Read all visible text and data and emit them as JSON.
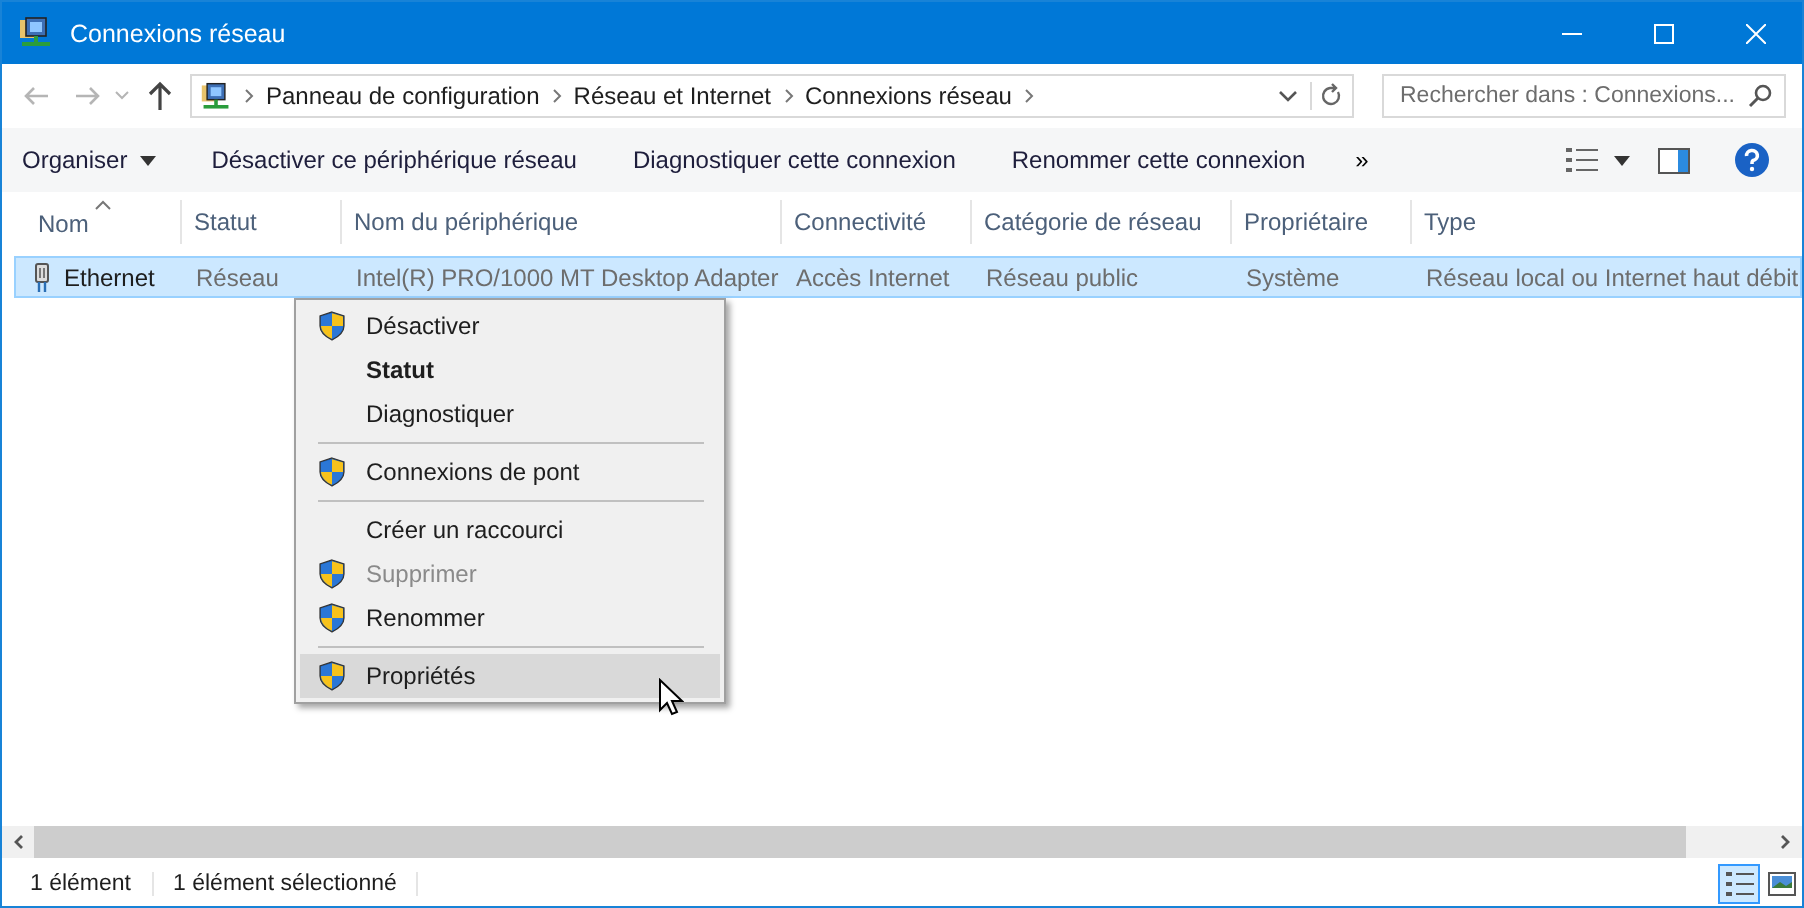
{
  "window": {
    "title": "Connexions réseau"
  },
  "address": {
    "crumbs": [
      "Panneau de configuration",
      "Réseau et Internet",
      "Connexions réseau"
    ]
  },
  "search": {
    "placeholder": "Rechercher dans : Connexions..."
  },
  "toolbar": {
    "items": [
      {
        "label": "Organiser",
        "dropdown": true
      },
      {
        "label": "Désactiver ce périphérique réseau",
        "dropdown": false
      },
      {
        "label": "Diagnostiquer cette connexion",
        "dropdown": false
      },
      {
        "label": "Renommer cette connexion",
        "dropdown": false
      }
    ],
    "more": "»"
  },
  "table": {
    "columns": [
      {
        "label": "Nom",
        "sorted": true
      },
      {
        "label": "Statut",
        "sorted": false
      },
      {
        "label": "Nom du périphérique",
        "sorted": false
      },
      {
        "label": "Connectivité",
        "sorted": false
      },
      {
        "label": "Catégorie de réseau",
        "sorted": false
      },
      {
        "label": "Propriétaire",
        "sorted": false
      },
      {
        "label": "Type",
        "sorted": false
      }
    ],
    "rows": [
      {
        "selected": true,
        "cells": [
          "Ethernet",
          "Réseau",
          "Intel(R) PRO/1000 MT Desktop Adapter",
          "Accès Internet",
          "Réseau public",
          "Système",
          "Réseau local ou Internet haut débit"
        ]
      }
    ]
  },
  "context_menu": {
    "items": [
      {
        "kind": "item",
        "label": "Désactiver",
        "shield": true,
        "bold": false,
        "disabled": false,
        "selected": false
      },
      {
        "kind": "item",
        "label": "Statut",
        "shield": false,
        "bold": true,
        "disabled": false,
        "selected": false
      },
      {
        "kind": "item",
        "label": "Diagnostiquer",
        "shield": false,
        "bold": false,
        "disabled": false,
        "selected": false
      },
      {
        "kind": "separator"
      },
      {
        "kind": "item",
        "label": "Connexions de pont",
        "shield": true,
        "bold": false,
        "disabled": false,
        "selected": false
      },
      {
        "kind": "separator"
      },
      {
        "kind": "item",
        "label": "Créer un raccourci",
        "shield": false,
        "bold": false,
        "disabled": false,
        "selected": false
      },
      {
        "kind": "item",
        "label": "Supprimer",
        "shield": true,
        "bold": false,
        "disabled": true,
        "selected": false
      },
      {
        "kind": "item",
        "label": "Renommer",
        "shield": true,
        "bold": false,
        "disabled": false,
        "selected": false
      },
      {
        "kind": "separator"
      },
      {
        "kind": "item",
        "label": "Propriétés",
        "shield": true,
        "bold": false,
        "disabled": false,
        "selected": true
      }
    ]
  },
  "status_bar": {
    "items": [
      "1 élément",
      "1 élément sélectionné"
    ],
    "views": [
      {
        "selected": true
      },
      {
        "selected": false
      }
    ]
  }
}
